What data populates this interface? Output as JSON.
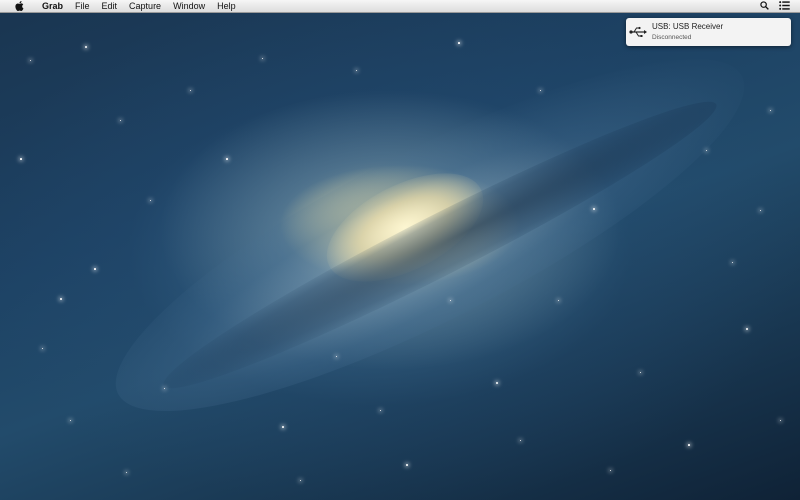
{
  "menubar": {
    "apple_icon": "apple-logo-icon",
    "app_name": "Grab",
    "menus": [
      "File",
      "Edit",
      "Capture",
      "Window",
      "Help"
    ],
    "right_icons": [
      "spotlight-search-icon",
      "notification-center-icon"
    ]
  },
  "notification": {
    "icon": "usb-icon",
    "title": "USB: USB Receiver",
    "subtitle": "Disconnected"
  },
  "desktop": {
    "wallpaper": "galaxy",
    "colors": {
      "space": "#1d4264",
      "core": "#fff4c8"
    }
  }
}
